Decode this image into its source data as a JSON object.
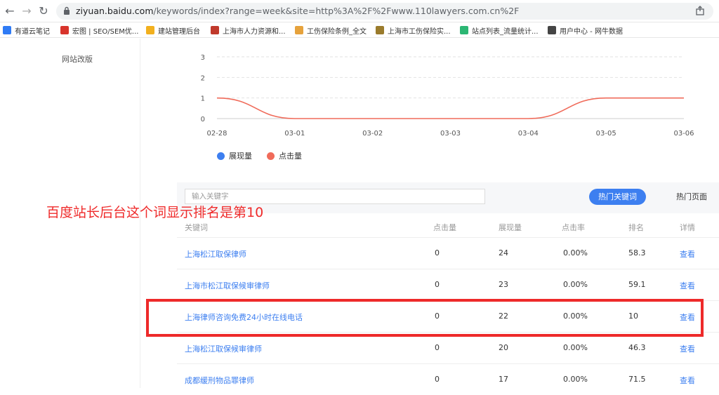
{
  "browser": {
    "url_host": "ziyuan.baidu.com",
    "url_path": "/keywords/index?range=week&site=http%3A%2F%2Fwww.110lawyers.com.cn%2F"
  },
  "bookmarks": [
    {
      "label": "有道云笔记",
      "color": "#2f7bf5"
    },
    {
      "label": "宏图 | SEO/SEM优...",
      "color": "#d8342c"
    },
    {
      "label": "建站管理后台",
      "color": "#f2b01e"
    },
    {
      "label": "上海市人力资源和...",
      "color": "#c0392b"
    },
    {
      "label": "工伤保险条例_全文",
      "color": "#e6a23c"
    },
    {
      "label": "上海市工伤保险实...",
      "color": "#9a7b2c"
    },
    {
      "label": "站点列表_流量统计...",
      "color": "#2bb673"
    },
    {
      "label": "用户中心 - 网牛数据",
      "color": "#444444"
    }
  ],
  "sidebar": {
    "item_label": "网站改版"
  },
  "chart_data": {
    "type": "line",
    "x": [
      "02-28",
      "03-01",
      "03-02",
      "03-03",
      "03-04",
      "03-05",
      "03-06"
    ],
    "yticks": [
      "0",
      "1",
      "2",
      "3"
    ],
    "ylim": [
      0,
      3
    ],
    "series": [
      {
        "name": "展现量",
        "color": "#3d7ff0",
        "values": null
      },
      {
        "name": "点击量",
        "color": "#f06b5a",
        "values": [
          1,
          0,
          0,
          0,
          0,
          1,
          1
        ]
      }
    ],
    "legend": "bottom-left",
    "grid": true
  },
  "table": {
    "search_placeholder": "输入关键字",
    "tab_active": "热门关键词",
    "tab_other": "热门页面",
    "columns": [
      "关键词",
      "点击量",
      "展现量",
      "点击率",
      "排名",
      "详情"
    ],
    "rows": [
      {
        "keyword": "上海松江取保律师",
        "clicks": "0",
        "impressions": "24",
        "ctr": "0.00%",
        "rank": "58.3",
        "detail": "查看"
      },
      {
        "keyword": "上海市松江取保候审律师",
        "clicks": "0",
        "impressions": "23",
        "ctr": "0.00%",
        "rank": "59.1",
        "detail": "查看"
      },
      {
        "keyword": "上海律师咨询免费24小时在线电话",
        "clicks": "0",
        "impressions": "22",
        "ctr": "0.00%",
        "rank": "10",
        "detail": "查看"
      },
      {
        "keyword": "上海松江取保候审律师",
        "clicks": "0",
        "impressions": "20",
        "ctr": "0.00%",
        "rank": "46.3",
        "detail": "查看"
      },
      {
        "keyword": "成都缓刑物品罪律师",
        "clicks": "0",
        "impressions": "17",
        "ctr": "0.00%",
        "rank": "71.5",
        "detail": "查看"
      }
    ]
  },
  "annotation": "百度站长后台这个词显示排名是第10",
  "colors": {
    "accent": "#3d7ff0",
    "highlight": "#ee2a2a"
  }
}
